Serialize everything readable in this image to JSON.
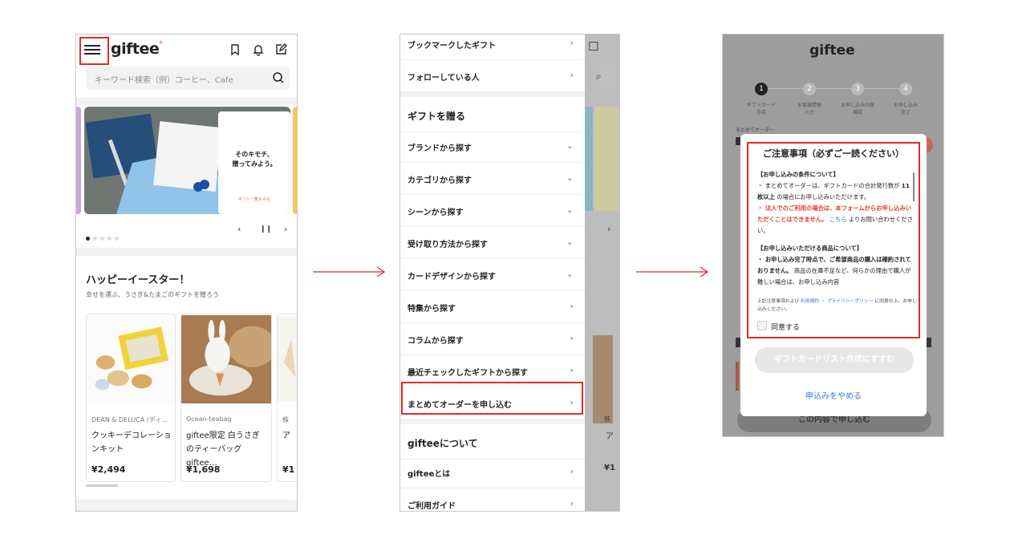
{
  "screen1": {
    "logo": "giftee",
    "search_placeholder": "キーワード検索（例）コーヒー、Cafe",
    "banner_text": "そのキモチ、\n贈ってみよう。",
    "banner_link": "ギフト一覧をみる",
    "section_title": "ハッピーイースター！",
    "section_subtitle": "幸せを運ぶ、うさぎ&たまごのギフトを贈ろう",
    "products": [
      {
        "brand": "DEAN & DELUCA (ディ…",
        "name": "クッキーデコレーションキット",
        "price": "¥2,494"
      },
      {
        "brand": "Ocean-teabag",
        "name": "giftee限定 白うさぎのティーバッグgiftee…",
        "price": "¥1,698"
      },
      {
        "brand": "株",
        "name": "ア",
        "price": "¥1"
      }
    ],
    "icons": [
      "menu-icon",
      "bookmark-icon",
      "bell-icon",
      "edit-icon",
      "search-icon"
    ]
  },
  "screen2": {
    "items_top": [
      {
        "label": "ブックマークしたギフト",
        "chevron": "›"
      },
      {
        "label": "フォローしている人",
        "chevron": "›"
      }
    ],
    "section1": "ギフトを贈る",
    "items_main": [
      {
        "label": "ブランドから探す",
        "chevron": "⌄"
      },
      {
        "label": "カテゴリから探す",
        "chevron": "⌄"
      },
      {
        "label": "シーンから探す",
        "chevron": "⌄"
      },
      {
        "label": "受け取り方法から探す",
        "chevron": "⌄"
      },
      {
        "label": "カードデザインから探す",
        "chevron": "⌄"
      },
      {
        "label": "特集から探す",
        "chevron": "›"
      },
      {
        "label": "コラムから探す",
        "chevron": "›"
      },
      {
        "label": "最近チェックしたギフトから探す",
        "chevron": "›"
      },
      {
        "label": "まとめてオーダーを申し込む",
        "chevron": "›"
      }
    ],
    "section2": "gifteeについて",
    "items_about": [
      {
        "label": "gifteeとは",
        "chevron": "›"
      },
      {
        "label": "ご利用ガイド",
        "chevron": "›"
      }
    ]
  },
  "screen3": {
    "logo": "giftee",
    "steps": [
      {
        "num": "1",
        "label": "ギフトカード\n作成"
      },
      {
        "num": "2",
        "label": "お客様情報\n入力"
      },
      {
        "num": "3",
        "label": "お申し込み内容\n確認"
      },
      {
        "num": "4",
        "label": "お申し込み\n完了"
      }
    ],
    "order_label": "まとめてオーダー",
    "modal_title": "ご注意事項（必ずご一読ください）",
    "cond_heading": "【お申し込みの条件について】",
    "cond_1a": "・ まとめてオーダーは、ギフトカードの合計発行数が ",
    "cond_1b": "11枚以上",
    "cond_1c": " の場合にお申し込みいただけます。",
    "cond_2a": "・ 法人でのご利用の場合は、本フォームからお申し込みいただくことはできません。",
    "cond_2link": "こちら",
    "cond_2c": " よりお問い合わせください。",
    "prod_heading": "【お申し込みいただける商品について】",
    "prod_1a": "・ お申し込み完了時点で、ご希望商品の購入は確約されておりません。",
    "prod_1b": " 商品の在庫不足など、何らかの理由で購入が難しい場合は、お申し込み内容",
    "agree_note_a": "上記注意事項および ",
    "agree_terms": "利用規約",
    "agree_mid": " ・ ",
    "agree_privacy": "プライバシーポリシー",
    "agree_note_b": " に同意の上、お申し込みください。",
    "agree_label": "同意する",
    "primary_button": "ギフトカードリスト作成にすすむ",
    "cancel_link": "申込みをやめる",
    "bottom_button": "この内容で申し込む"
  }
}
